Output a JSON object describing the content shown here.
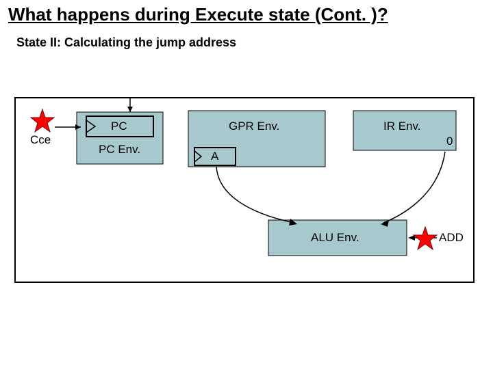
{
  "title": "What happens during Execute state (Cont. )?",
  "subtitle": "State II: Calculating the jump address",
  "labels": {
    "cce": "Cce",
    "pc": "PC",
    "pc_env": "PC Env.",
    "gpr_env": "GPR Env.",
    "ir_env": "IR Env.",
    "zero": "0",
    "a": "A",
    "alu_env": "ALU Env.",
    "add": "ADD"
  }
}
